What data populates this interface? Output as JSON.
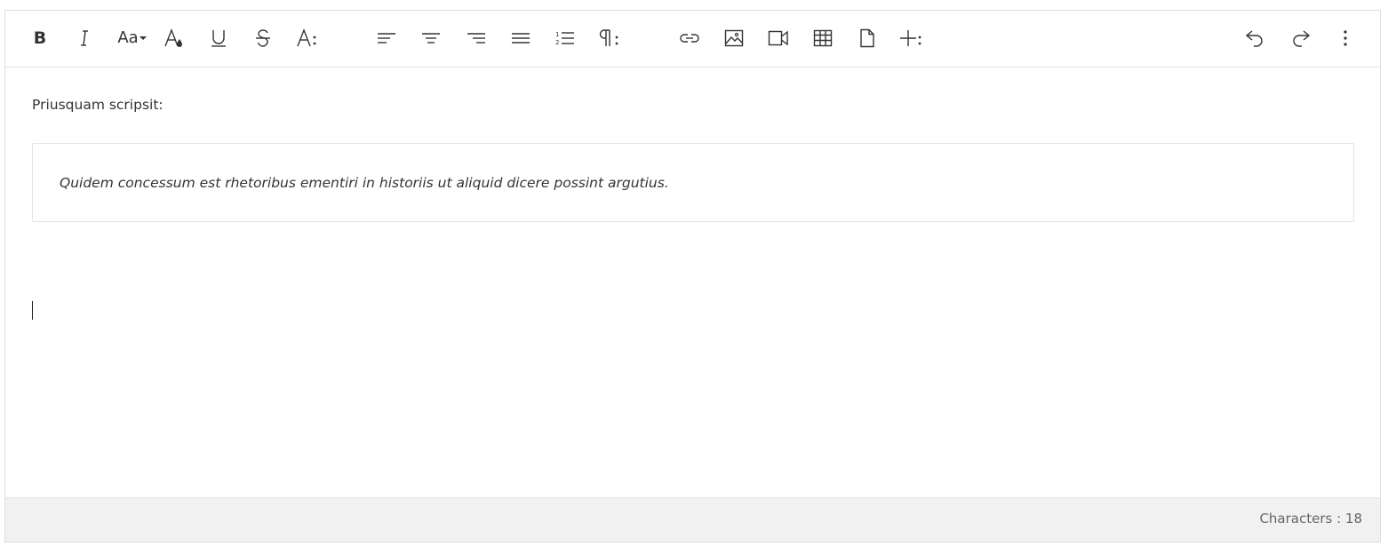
{
  "toolbar": {
    "groups": {
      "format": [
        "bold",
        "italic",
        "font-size",
        "text-color",
        "underline",
        "strikethrough",
        "more-text"
      ],
      "paragraph": [
        "align-left",
        "align-center",
        "align-right",
        "align-justify",
        "ordered-list",
        "more-paragraph"
      ],
      "insert": [
        "insert-link",
        "insert-image",
        "insert-video",
        "insert-table",
        "insert-file",
        "more-insert"
      ],
      "history": [
        "undo",
        "redo",
        "more-misc"
      ]
    },
    "glyphs": {
      "bold": "B",
      "italic": "I",
      "font_size": "Aa",
      "text_color": "A",
      "underline": "U",
      "strikethrough": "S",
      "more_text": "A",
      "more_paragraph": "¶"
    },
    "icon_color": "#333333"
  },
  "content": {
    "paragraph": "Priusquam scripsit:",
    "blockquote": "Quidem concessum est rhetoribus ementiri in historiis ut aliquid dicere possint argutius."
  },
  "status": {
    "char_count_label": "Characters : 18"
  }
}
